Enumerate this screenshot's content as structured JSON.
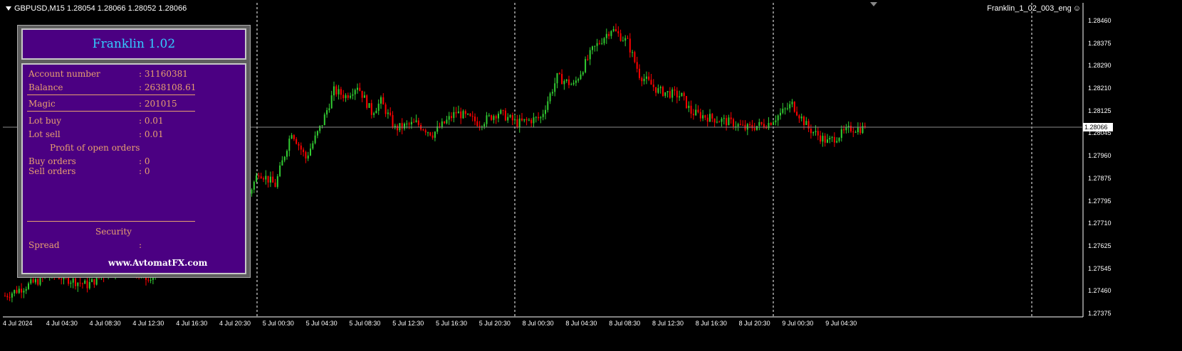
{
  "header": {
    "symbol_info": "GBPUSD,M15  1.28054 1.28066 1.28052 1.28066"
  },
  "ea_label": "Franklin_1_02_003_eng",
  "current_price": "1.28066",
  "y_axis_labels": [
    "1.28460",
    "1.28375",
    "1.28290",
    "1.28210",
    "1.28125",
    "1.28045",
    "1.27960",
    "1.27875",
    "1.27795",
    "1.27710",
    "1.27625",
    "1.27545",
    "1.27460",
    "1.27375"
  ],
  "x_axis_labels": [
    "4 Jul 2024",
    "4 Jul 04:30",
    "4 Jul 08:30",
    "4 Jul 12:30",
    "4 Jul 16:30",
    "4 Jul 20:30",
    "5 Jul 00:30",
    "5 Jul 04:30",
    "5 Jul 08:30",
    "5 Jul 12:30",
    "5 Jul 16:30",
    "5 Jul 20:30",
    "8 Jul 00:30",
    "8 Jul 04:30",
    "8 Jul 08:30",
    "8 Jul 12:30",
    "8 Jul 16:30",
    "8 Jul 20:30",
    "9 Jul 00:30",
    "9 Jul 04:30"
  ],
  "colors": {
    "bull": "#32cd32",
    "bear": "#ff0000",
    "background": "#000000",
    "panel_bg": "#4b0082",
    "panel_text": "#e8a070",
    "title": "#33ccff"
  },
  "panel": {
    "title": "Franklin 1.02",
    "rows": [
      {
        "label": "Account number",
        "value": ": 31160381"
      },
      {
        "label": "Balance",
        "value": ": 2638108.61"
      },
      {
        "label": "Magic",
        "value": ": 201015"
      },
      {
        "label": "Lot buy",
        "value": ": 0.01"
      },
      {
        "label": "Lot sell",
        "value": ": 0.01"
      },
      {
        "label": "Buy orders",
        "value": ": 0"
      },
      {
        "label": "Sell orders",
        "value": ": 0"
      },
      {
        "label": "Spread",
        "value": ":"
      }
    ],
    "profit_heading": "Profit of open orders",
    "security_heading": "Security",
    "website": "www.AvtomatFX.com"
  },
  "chart_data": {
    "type": "candlestick",
    "symbol": "GBPUSD",
    "timeframe": "M15",
    "ylim": [
      1.2733,
      1.2851
    ],
    "last_price": 1.28066,
    "anchor_path": [
      [
        0,
        1.2744
      ],
      [
        20,
        1.2752
      ],
      [
        35,
        1.2748
      ],
      [
        50,
        1.2756
      ],
      [
        62,
        1.2749
      ],
      [
        68,
        1.2762
      ],
      [
        80,
        1.2768
      ],
      [
        88,
        1.2773
      ],
      [
        98,
        1.277
      ],
      [
        108,
        1.279
      ],
      [
        115,
        1.2785
      ],
      [
        122,
        1.2805
      ],
      [
        128,
        1.2795
      ],
      [
        135,
        1.2808
      ],
      [
        140,
        1.282
      ],
      [
        145,
        1.2818
      ],
      [
        150,
        1.2822
      ],
      [
        156,
        1.2812
      ],
      [
        160,
        1.2816
      ],
      [
        166,
        1.2806
      ],
      [
        175,
        1.2808
      ],
      [
        182,
        1.2804
      ],
      [
        192,
        1.2812
      ],
      [
        202,
        1.2808
      ],
      [
        210,
        1.2812
      ],
      [
        218,
        1.2808
      ],
      [
        228,
        1.281
      ],
      [
        235,
        1.2825
      ],
      [
        242,
        1.2822
      ],
      [
        250,
        1.2835
      ],
      [
        258,
        1.2843
      ],
      [
        265,
        1.2838
      ],
      [
        270,
        1.2826
      ],
      [
        278,
        1.282
      ],
      [
        288,
        1.2818
      ],
      [
        292,
        1.2812
      ],
      [
        300,
        1.281
      ],
      [
        310,
        1.2808
      ],
      [
        315,
        1.2806
      ],
      [
        325,
        1.2808
      ],
      [
        335,
        1.2815
      ],
      [
        342,
        1.2806
      ],
      [
        350,
        1.2801
      ],
      [
        360,
        1.2806
      ],
      [
        366,
        1.2806
      ]
    ]
  }
}
